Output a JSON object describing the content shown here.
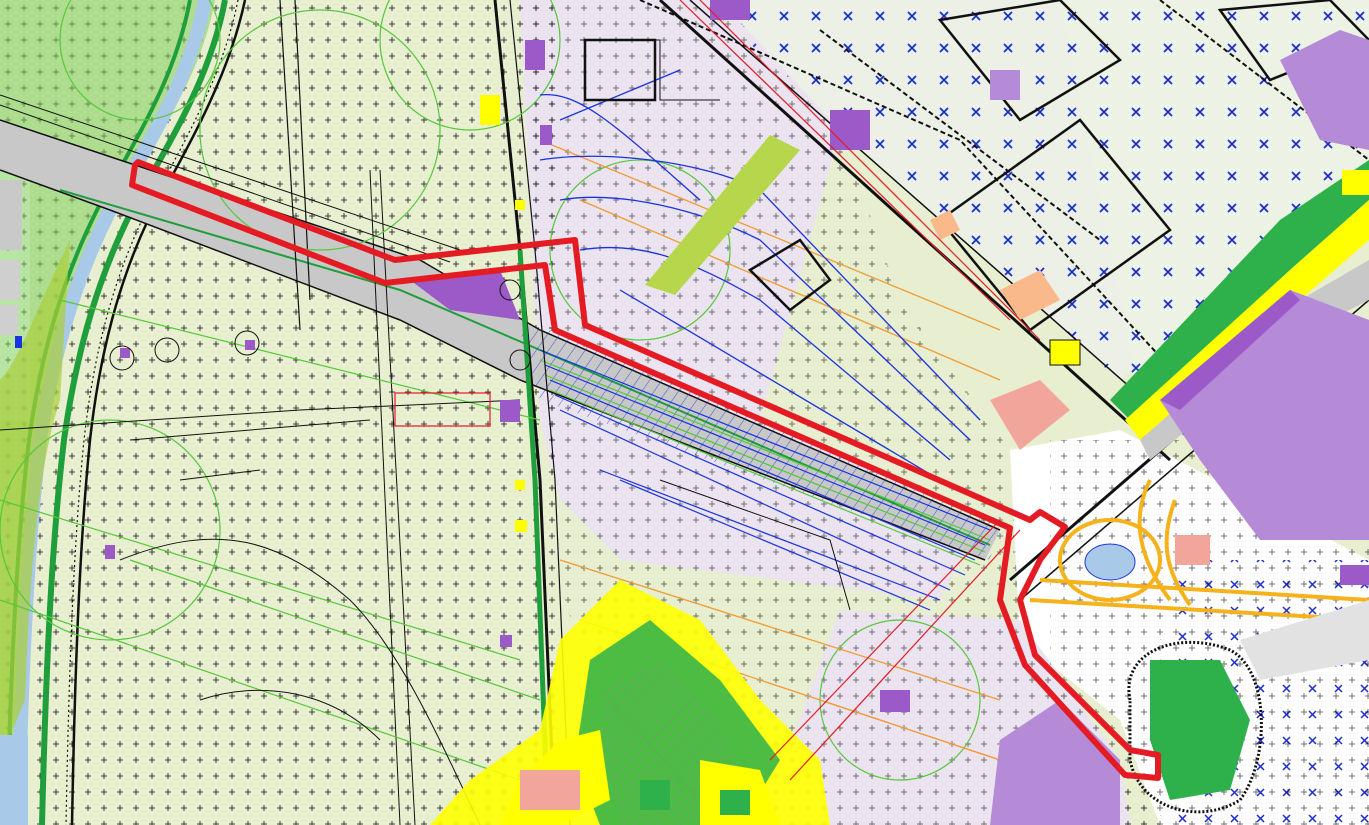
{
  "map": {
    "kind": "zoning-plan-map",
    "colors": {
      "agricultural": "#e8eed0",
      "grassland": "#dfe9c4",
      "river_green": "#1f9e3c",
      "river_green_light": "#7dcf5a",
      "water": "#a9c9e8",
      "commercial_pink": "#e9e1ee",
      "industrial_purple": "#b58bd8",
      "industrial_purple_dark": "#9c5ac9",
      "residential_yellow": "#ffff00",
      "salmon": "#f2a69b",
      "orange_peach": "#f9b98a",
      "road_grey": "#c8c8c8",
      "highway_orange": "#f5b21a",
      "boundary_red": "#e51b24",
      "utility_blue": "#1a33e0",
      "green_contour": "#55c83a",
      "orange_line": "#f29b32",
      "park_green": "#2eb04a",
      "olive_green": "#b6d74b",
      "cross_blue": "#1a2ad6",
      "black": "#111111"
    },
    "legend_icons": [
      "plus-pattern",
      "cross-pattern",
      "hatch-line"
    ]
  }
}
